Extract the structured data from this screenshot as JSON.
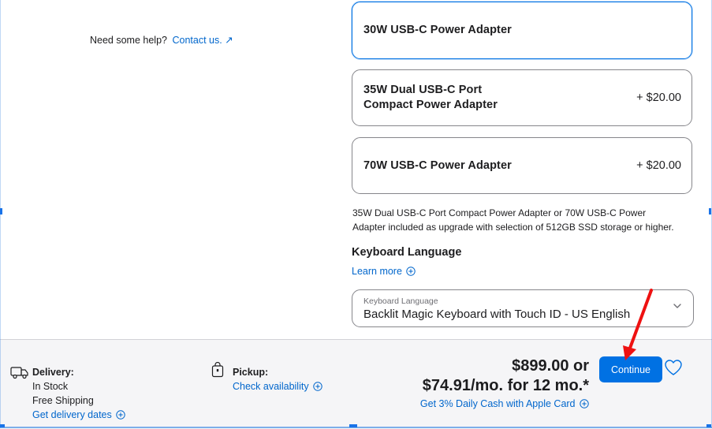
{
  "help": {
    "text": "Need some help?",
    "link": "Contact us. ↗"
  },
  "power_adapter": {
    "options": [
      {
        "title_line1": "30W USB-C Power Adapter",
        "title_line2": "",
        "price": "",
        "selected": true
      },
      {
        "title_line1": "35W Dual USB-C Port",
        "title_line2": "Compact Power Adapter",
        "price": "+ $20.00",
        "selected": false
      },
      {
        "title_line1": "70W USB-C Power Adapter",
        "title_line2": "",
        "price": "+ $20.00",
        "selected": false
      }
    ],
    "note_line1": "35W Dual USB-C Port Compact Power Adapter or 70W USB-C Power",
    "note_line2": "Adapter included as upgrade with selection of 512GB SSD storage or higher."
  },
  "keyboard": {
    "heading": "Keyboard Language",
    "learn_more": "Learn more",
    "select_label": "Keyboard Language",
    "select_value": "Backlit Magic Keyboard with Touch ID - US English"
  },
  "footer": {
    "delivery": {
      "heading": "Delivery:",
      "status": "In Stock",
      "shipping": "Free Shipping",
      "link": "Get delivery dates"
    },
    "pickup": {
      "heading": "Pickup:",
      "link": "Check availability"
    },
    "price_line1": "$899.00 or",
    "price_line2": "$74.91/mo. for 12 mo.*",
    "cash_link": "Get 3% Daily Cash with Apple Card",
    "continue_label": "Continue"
  },
  "colors": {
    "accent": "#0071e3",
    "link": "#0066cc",
    "annotation": "#ee1111"
  }
}
